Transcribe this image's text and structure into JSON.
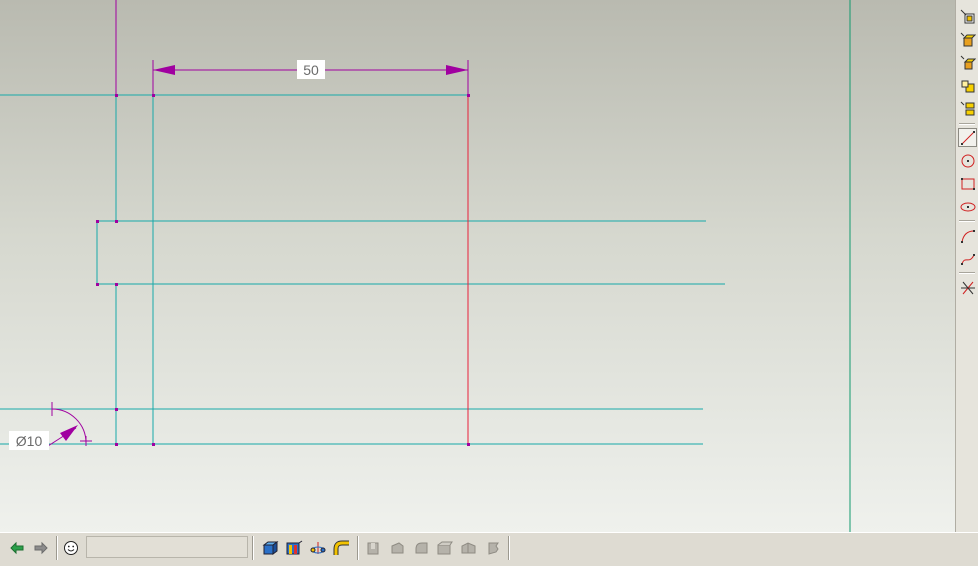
{
  "sketch": {
    "dimension_linear": "50",
    "dimension_diameter": "Ø10"
  },
  "colors": {
    "sketch_line": "#17a9a9",
    "dimension": "#a000a0",
    "selected_line": "#e8203a",
    "reference_line": "#119a6e"
  },
  "right_toolbar": {
    "icons": [
      "sketch-new-icon",
      "extrude-icon",
      "revolve-icon",
      "sweep-icon",
      "blend-icon",
      "line-icon",
      "circle-icon",
      "rectangle-icon",
      "ellipse-icon",
      "arc-icon",
      "spline-icon",
      "trim-icon"
    ]
  },
  "bottom_toolbar": {
    "icons": [
      "arrow-left-icon",
      "arrow-right-icon",
      "smiley-icon",
      "box-3d-icon",
      "datum-plane-icon",
      "axis-icon",
      "pipe-icon",
      "disabled-tool-1-icon",
      "disabled-tool-2-icon",
      "disabled-tool-3-icon",
      "disabled-tool-4-icon",
      "disabled-tool-5-icon",
      "disabled-tool-6-icon"
    ]
  }
}
